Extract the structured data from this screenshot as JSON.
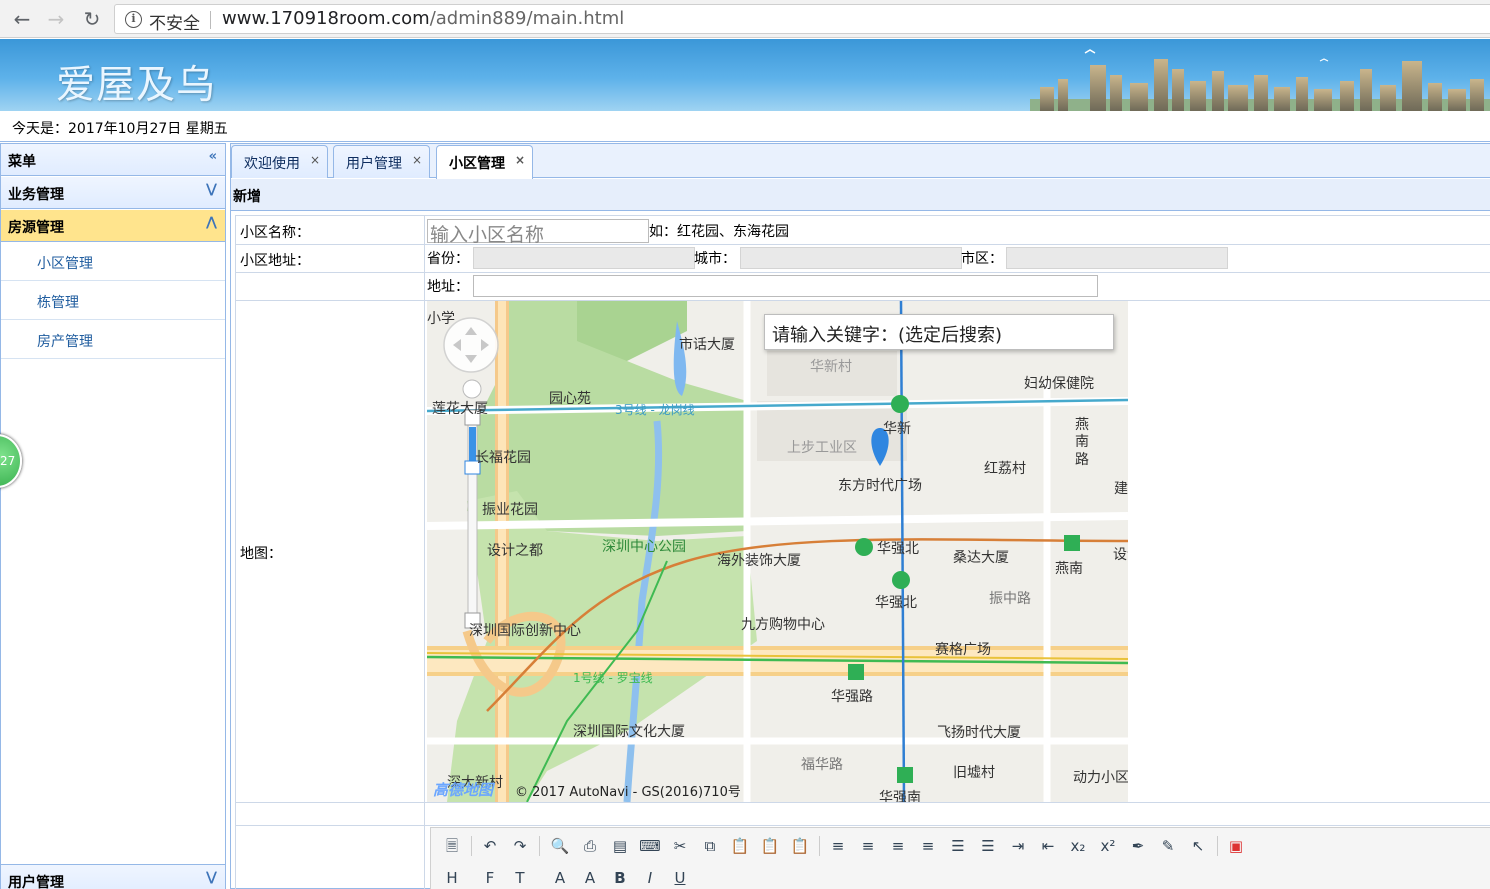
{
  "browser": {
    "security": "不安全",
    "url_host": "www.170918room.com",
    "url_path": "/admin889/main.html"
  },
  "header": {
    "site_title": "爱屋及乌",
    "date_text": "今天是：2017年10月27日 星期五"
  },
  "sidebar": {
    "title": "菜单",
    "collapse_icon": "double-chevron-left-icon",
    "groups": [
      {
        "label": "业务管理",
        "state": "collapsed"
      },
      {
        "label": "房源管理",
        "state": "expanded"
      }
    ],
    "items": [
      {
        "label": "小区管理"
      },
      {
        "label": "栋管理"
      },
      {
        "label": "房产管理"
      }
    ],
    "bottom_group": {
      "label": "用户管理"
    },
    "float_badge": "27"
  },
  "tabs": [
    {
      "label": "欢迎使用",
      "close": "×"
    },
    {
      "label": "用户管理",
      "close": "×"
    },
    {
      "label": "小区管理",
      "close": "×",
      "selected": true
    }
  ],
  "panel": {
    "title": "新增"
  },
  "form": {
    "name_label": "小区名称：",
    "name_placeholder": "输入小区名称",
    "name_hint": "如：红花园、东海花园",
    "address_label": "小区地址：",
    "province_label": "省份：",
    "city_label": "城市：",
    "district_label": "市区：",
    "address_line_label": "地址：",
    "map_label": "地图："
  },
  "map": {
    "search_placeholder": "请输入关键字：(选定后搜索)",
    "copyright": "© 2017 AutoNavi - GS(2016)710号",
    "logo": "高德地图",
    "labels": [
      "小学",
      "市话大厦",
      "华新村",
      "妇幼保健院",
      "园心苑",
      "莲花大厦",
      "3号线 - 龙岗线",
      "华新",
      "上步工业区",
      "燕南路",
      "红荔村",
      "长福花园",
      "东方时代广场",
      "建",
      "振业花园",
      "设计之都",
      "深圳中心公园",
      "海外装饰大厦",
      "华强北",
      "桑达大厦",
      "燕南",
      "设计",
      "振中路",
      "九方购物中心",
      "深圳国际创新中心",
      "赛格广场",
      "1号线 - 罗宝线",
      "华强路",
      "深圳国际文化大厦",
      "飞扬时代大厦",
      "福华路",
      "旧墟村",
      "动力小区",
      "深大新村",
      "华强南"
    ]
  },
  "colors": {
    "accent_border": "#95b8e7",
    "active_group": "#ffe48d",
    "link": "#205d9f"
  }
}
